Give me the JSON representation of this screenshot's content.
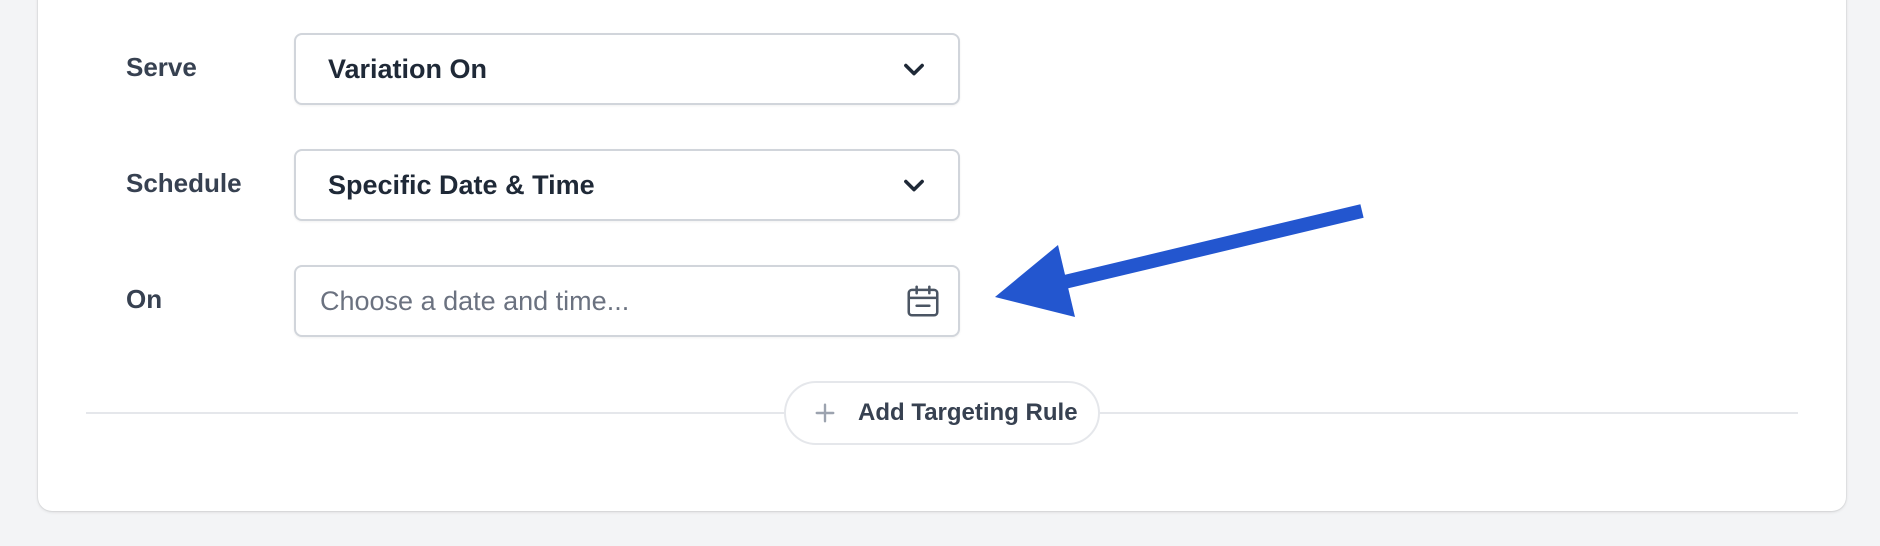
{
  "form": {
    "serve": {
      "label": "Serve",
      "value": "Variation On",
      "icon": "chevron-down-icon"
    },
    "schedule": {
      "label": "Schedule",
      "value": "Specific Date & Time",
      "icon": "chevron-down-icon"
    },
    "on": {
      "label": "On",
      "placeholder": "Choose a date and time...",
      "value": "",
      "icon": "calendar-icon"
    }
  },
  "actions": {
    "add_targeting_rule": "Add Targeting Rule",
    "add_icon": "plus-icon"
  },
  "annotation": {
    "icon": "arrow-pointer-icon",
    "color": "#2356cf"
  }
}
